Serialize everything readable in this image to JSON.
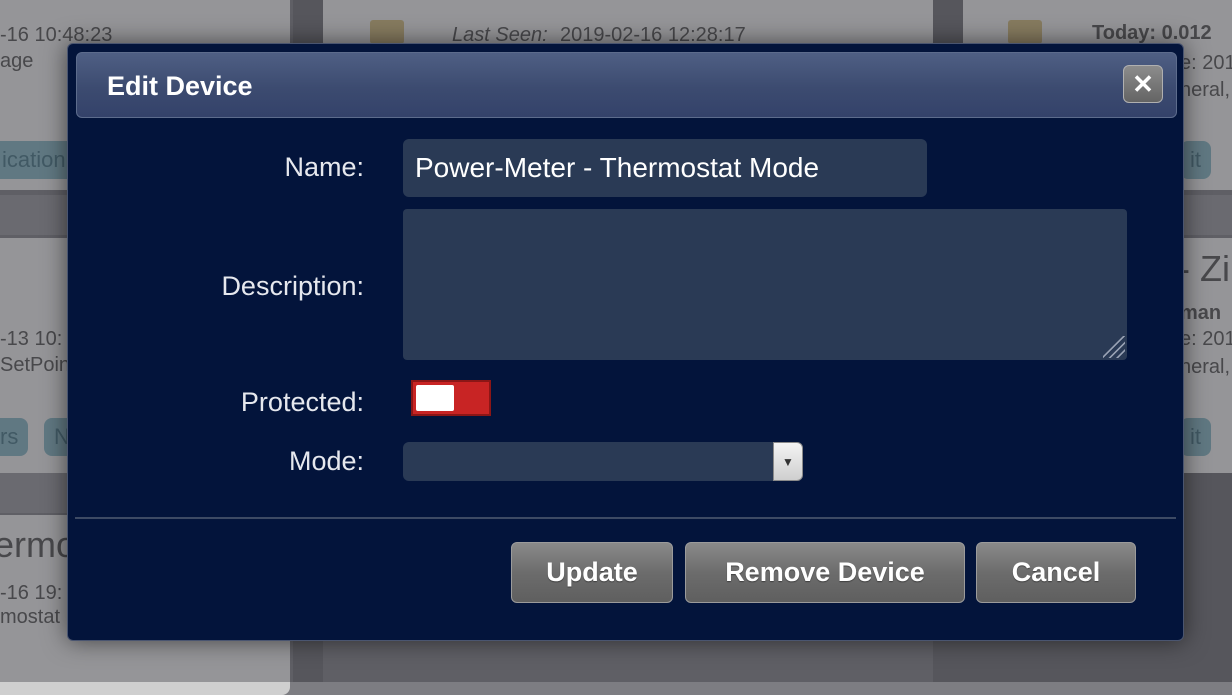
{
  "background": {
    "left_card": {
      "timestamp_1": "-16 10:48:23",
      "text_1": "age",
      "button_1": "ication",
      "timestamp_2": "-13 10:",
      "text_2": "SetPoint",
      "button_2": "rs",
      "button_3": "N",
      "heading_3": "ermos",
      "timestamp_3": "-16 19:",
      "text_3": "mostat"
    },
    "middle_card": {
      "last_seen_label": "Last Seen:",
      "last_seen_value": "2019-02-16 12:28:17"
    },
    "right_card": {
      "today_label": "Today: 0.012",
      "text_1": "e: 201",
      "text_2": "neral,",
      "button_1": "it",
      "heading_2": "- Zi",
      "bold_2": "man",
      "text_3": "e: 201",
      "text_4": "neral,",
      "button_2": "it"
    }
  },
  "dialog": {
    "title": "Edit Device",
    "close_icon": "close-icon",
    "fields": {
      "name_label": "Name:",
      "name_value": "Power-Meter - Thermostat Mode",
      "description_label": "Description:",
      "description_value": "",
      "protected_label": "Protected:",
      "protected_on": false,
      "mode_label": "Mode:",
      "mode_value": ""
    },
    "buttons": {
      "update": "Update",
      "remove": "Remove Device",
      "cancel": "Cancel"
    },
    "colors": {
      "background": "#03143b",
      "titlebar": "#3c4b70",
      "toggle_off": "#c82424",
      "input_bg": "#2a3a55"
    }
  }
}
